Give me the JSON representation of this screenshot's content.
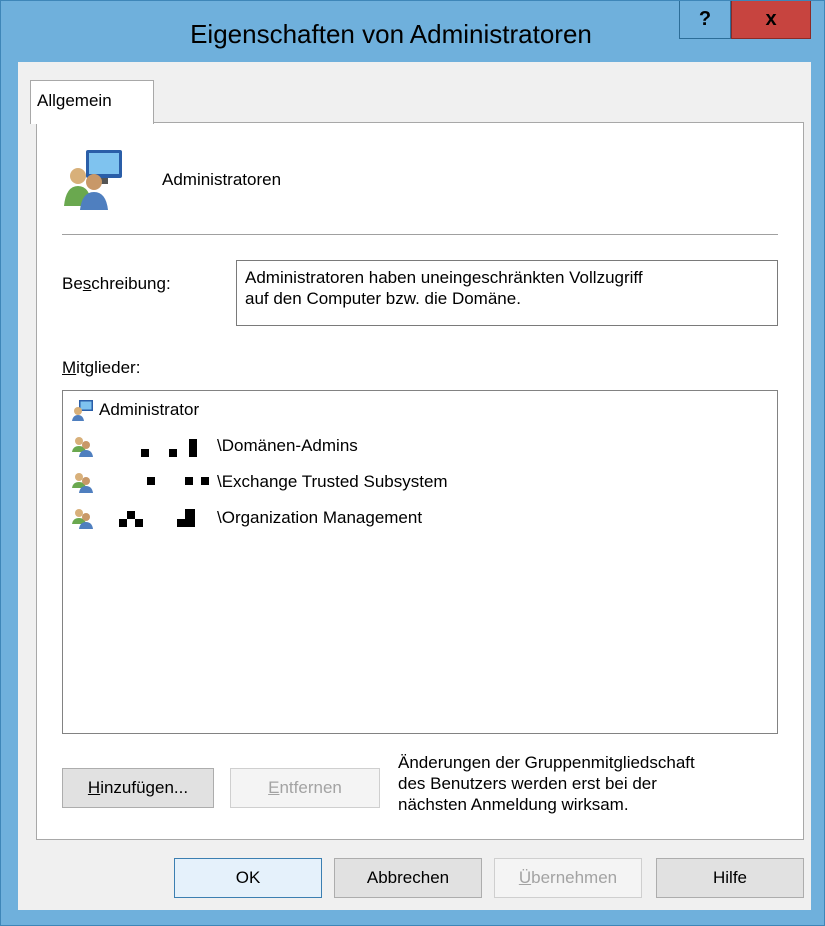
{
  "window": {
    "title": "Eigenschaften von Administratoren",
    "help_label": "?",
    "close_label": "x"
  },
  "tabs": [
    {
      "label": "Allgemein"
    }
  ],
  "general": {
    "group_name": "Administratoren",
    "description_label_pre": "Be",
    "description_label_key": "s",
    "description_label_post": "chreibung:",
    "description_line1": "Administratoren haben uneingeschränkten Vollzugriff",
    "description_line2": "auf den Computer bzw. die Domäne.",
    "members_label_key": "M",
    "members_label_post": "itglieder:",
    "members": [
      {
        "text": "Administrator",
        "icon": "user-computer-icon"
      },
      {
        "text": "\\Domänen-Admins",
        "icon": "group-icon"
      },
      {
        "text": "\\Exchange Trusted Subsystem",
        "icon": "group-icon"
      },
      {
        "text": "\\Organization Management",
        "icon": "group-icon"
      }
    ],
    "add_key": "H",
    "add_rest": "inzufügen...",
    "remove_key": "E",
    "remove_rest": "ntfernen",
    "note_line1": "Änderungen der Gruppenmitgliedschaft",
    "note_line2": "des Benutzers werden erst bei der",
    "note_line3": "nächsten Anmeldung wirksam."
  },
  "footer": {
    "ok": "OK",
    "cancel": "Abbrechen",
    "apply_key": "Ü",
    "apply_rest": "bernehmen",
    "help": "Hilfe"
  },
  "colors": {
    "titlebar": "#6fb0dc",
    "close_button": "#c7443f",
    "dialog_background": "#f0f0f0"
  }
}
